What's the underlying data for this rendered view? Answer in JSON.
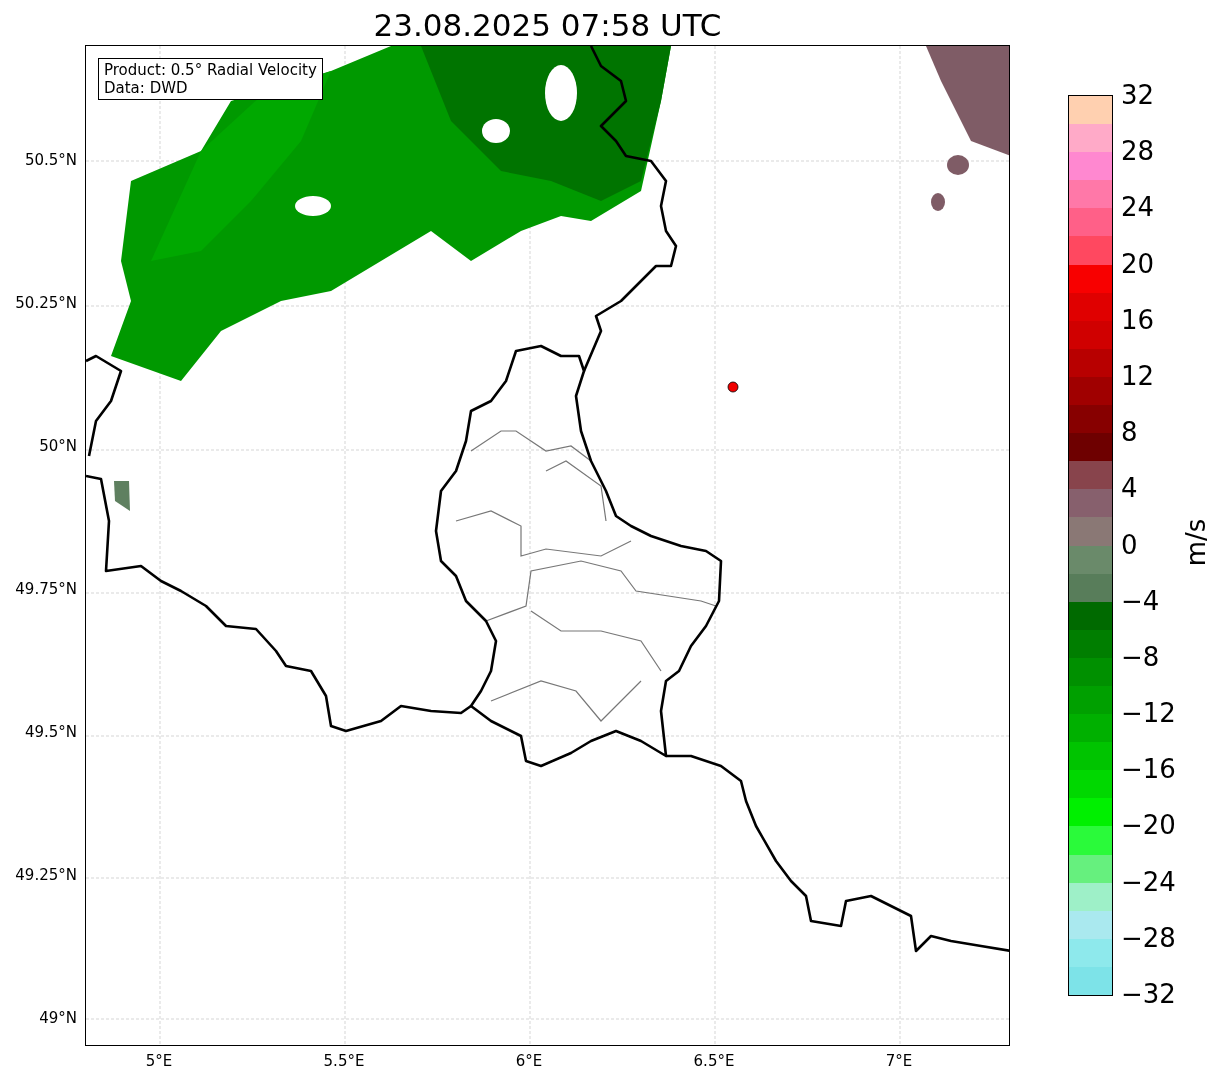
{
  "title": "23.08.2025 07:58 UTC",
  "info_box": [
    "Product: 0.5° Radial Velocity",
    "Data: DWD"
  ],
  "y_ticks": [
    "50.5°N",
    "50.25°N",
    "50°N",
    "49.75°N",
    "49.5°N",
    "49.25°N",
    "49°N"
  ],
  "x_ticks": [
    "5°E",
    "5.5°E",
    "6°E",
    "6.5°E",
    "7°E"
  ],
  "colorbar": {
    "label": "m/s",
    "ticks": [
      "32",
      "28",
      "24",
      "20",
      "16",
      "12",
      "8",
      "4",
      "0",
      "−4",
      "−8",
      "−12",
      "−16",
      "−20",
      "−24",
      "−28",
      "−32"
    ],
    "bands": [
      {
        "color": "#ffd0b0"
      },
      {
        "color": "#ffaac8"
      },
      {
        "color": "#ff88d0"
      },
      {
        "color": "#ff78a8"
      },
      {
        "color": "#ff6088"
      },
      {
        "color": "#ff4860"
      },
      {
        "color": "#f80000"
      },
      {
        "color": "#e00000"
      },
      {
        "color": "#d00000"
      },
      {
        "color": "#b80000"
      },
      {
        "color": "#a00000"
      },
      {
        "color": "#870000"
      },
      {
        "color": "#6e0000"
      },
      {
        "color": "#88444c"
      },
      {
        "color": "#87606d"
      },
      {
        "color": "#8a7875"
      },
      {
        "color": "#6a8a6a"
      },
      {
        "color": "#587d5a"
      },
      {
        "color": "#006a00"
      },
      {
        "color": "#007e00"
      },
      {
        "color": "#009000"
      },
      {
        "color": "#00a000"
      },
      {
        "color": "#00b000"
      },
      {
        "color": "#00c400"
      },
      {
        "color": "#00d800"
      },
      {
        "color": "#00f000"
      },
      {
        "color": "#2afa3a"
      },
      {
        "color": "#66f07e"
      },
      {
        "color": "#9ef0c8"
      },
      {
        "color": "#aae9ef"
      },
      {
        "color": "#8ee9ec"
      },
      {
        "color": "#7de3e8"
      }
    ]
  }
}
